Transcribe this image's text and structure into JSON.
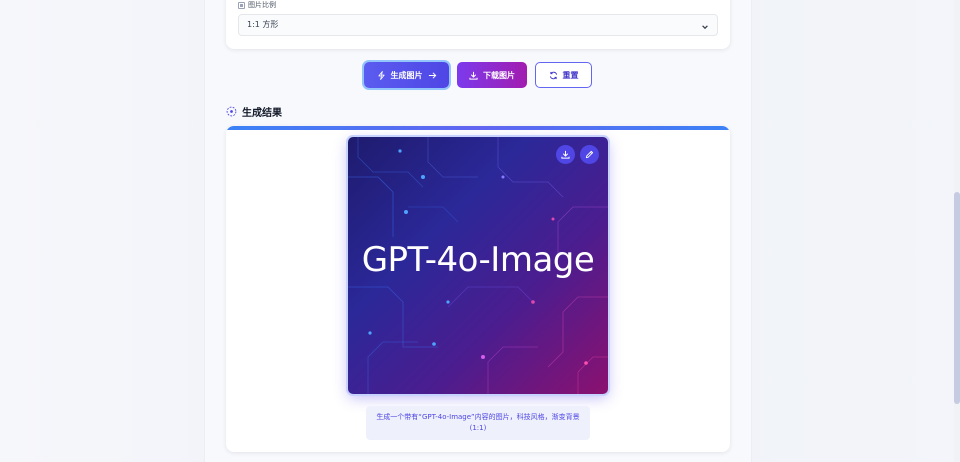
{
  "form": {
    "ratio_label": "图片比例",
    "ratio_value": "1:1 方形"
  },
  "actions": {
    "generate_label": "生成图片",
    "download_label": "下载图片",
    "reset_label": "重置"
  },
  "result": {
    "section_title": "生成结果",
    "image_text": "GPT-4o-Image",
    "caption_line1": "生成一个带有“GPT-4o-Image”内容的图片，科技风格，渐变背景",
    "caption_line2": "(1:1)"
  },
  "colors": {
    "primary": "#4f46e5",
    "purple": "#7c3aed",
    "accent_blue": "#3b82f6"
  },
  "icons": {
    "ratio": "ratio-icon",
    "generate": "sparkle-icon",
    "arrow": "arrow-right-icon",
    "download": "download-icon",
    "reset": "refresh-icon",
    "section": "target-icon",
    "edit": "pencil-icon"
  }
}
